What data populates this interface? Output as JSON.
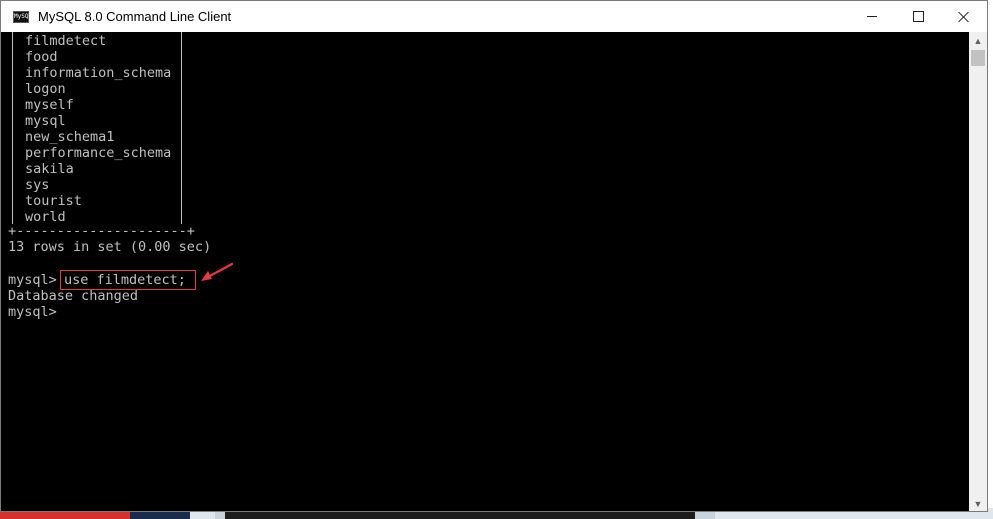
{
  "window": {
    "title": "MySQL 8.0 Command Line Client",
    "icon_text": "MySQL"
  },
  "databases": [
    "filmdetect",
    "food",
    "information_schema",
    "logon",
    "myself",
    "mysql",
    "new_schema1",
    "performance_schema",
    "sakila",
    "sys",
    "tourist",
    "world"
  ],
  "console": {
    "table_border": "+---------------------+",
    "rows_summary": "13 rows in set (0.00 sec)",
    "prompt1": "mysql>",
    "command": "use filmdetect;",
    "response": "Database changed",
    "prompt2": "mysql>"
  },
  "colors": {
    "console_bg": "#000000",
    "console_text": "#c0c0c0",
    "highlight": "#e23b3b"
  },
  "icons": {
    "minimize": "minimize-icon",
    "maximize": "maximize-icon",
    "close": "close-icon",
    "scroll_up": "chevron-up-icon",
    "scroll_down": "chevron-down-icon",
    "annotation": "red-arrow-icon"
  }
}
